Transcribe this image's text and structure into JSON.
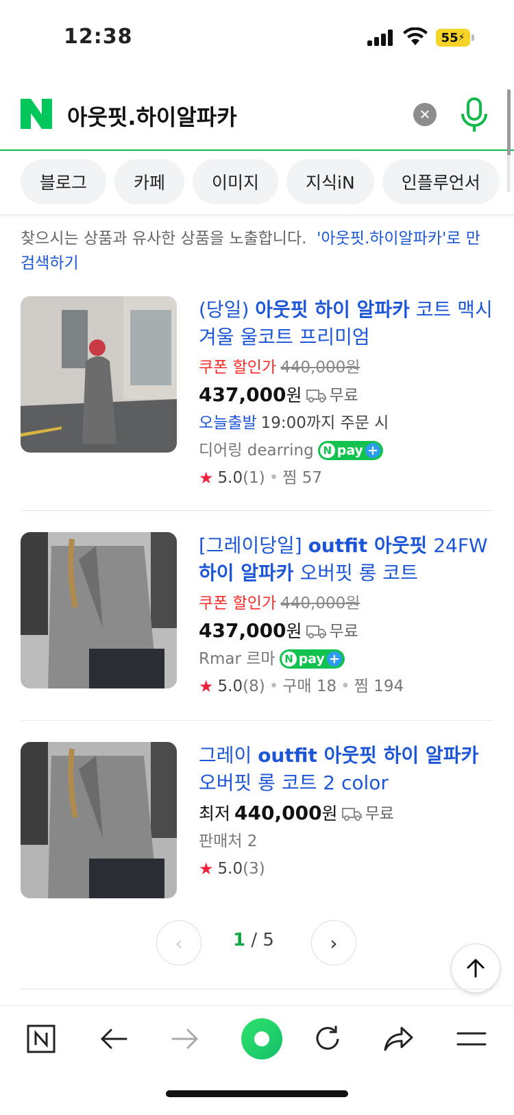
{
  "status_bar": {
    "time": "12:38",
    "battery": "55"
  },
  "search": {
    "query": "아웃핏.하이알파카"
  },
  "tabs": [
    "블로그",
    "카페",
    "이미지",
    "지식iN",
    "인플루언서"
  ],
  "notice": {
    "text": "찾으시는 상품과 유사한 상품을 노출합니다.",
    "link": "'아웃핏.하이알파카'로 만 검색하기"
  },
  "products": [
    {
      "title_prefix": "(당일) ",
      "title_bold": "아웃핏 하이 알파카",
      "title_rest": " 코트 맥시 겨울 울코트 프리미엄",
      "coupon_label": "쿠폰 할인가",
      "original_price": "440,000원",
      "price": "437,000",
      "price_unit": "원",
      "shipping": "무료",
      "today_ship": "오늘출발",
      "today_ship_note": "19:00까지 주문 시",
      "seller": "디어링 dearring",
      "rating": "5.0",
      "review_count": "(1)",
      "meta": "찜 57"
    },
    {
      "title_prefix": "[그레이당일] ",
      "title_bold": "outfit 아웃핏",
      "title_mid": " 24FW ",
      "title_bold2": "하이 알파카",
      "title_rest": " 오버핏 롱 코트",
      "coupon_label": "쿠폰 할인가",
      "original_price": "440,000원",
      "price": "437,000",
      "price_unit": "원",
      "shipping": "무료",
      "seller": "Rmar 르마",
      "rating": "5.0",
      "review_count": "(8)",
      "meta1": "구매 18",
      "meta2": "찜 194"
    },
    {
      "title_prefix": "그레이 ",
      "title_bold": "outfit 아웃핏 하이 알파카",
      "title_rest": " 오버핏 롱 코트 2 color",
      "lowest_label": "최저",
      "price": "440,000",
      "price_unit": "원",
      "shipping": "무료",
      "seller": "판매처 2",
      "rating": "5.0",
      "review_count": "(3)"
    }
  ],
  "pager": {
    "current": "1",
    "separator": " / ",
    "total": "5"
  },
  "npay_label": "pay",
  "colors": {
    "brand_green": "#11b84a",
    "link_blue": "#1c55d6",
    "coupon_red": "#ff2a2a"
  }
}
